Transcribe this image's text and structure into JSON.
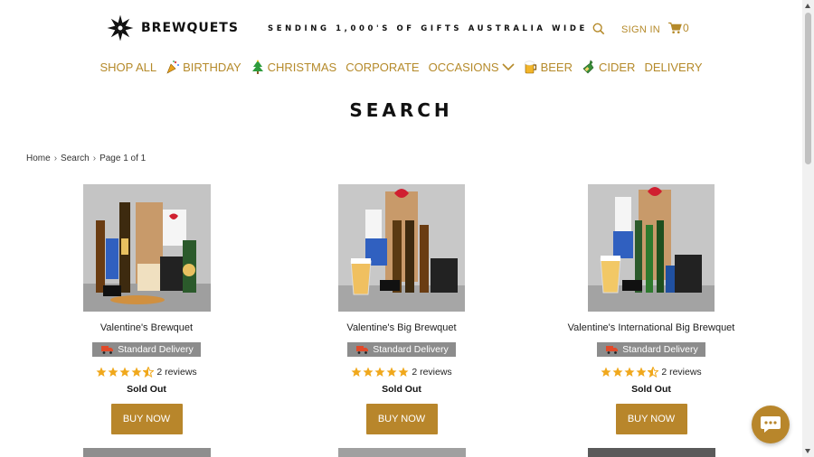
{
  "header": {
    "logo_text": "BREWQUETS",
    "tagline": "SENDING 1,000'S OF GIFTS AUSTRALIA WIDE",
    "signin_label": "SIGN IN",
    "cart_count": "0",
    "accent_color": "#b58a2a"
  },
  "nav": {
    "items": [
      {
        "label": "SHOP ALL",
        "icon": null
      },
      {
        "label": "BIRTHDAY",
        "icon": "party-popper-icon"
      },
      {
        "label": "CHRISTMAS",
        "icon": "christmas-tree-icon"
      },
      {
        "label": "CORPORATE",
        "icon": null
      },
      {
        "label": "OCCASIONS",
        "icon": "chevron-down-icon"
      },
      {
        "label": "BEER",
        "icon": "beer-mug-icon"
      },
      {
        "label": "CIDER",
        "icon": "bottle-icon"
      },
      {
        "label": "DELIVERY",
        "icon": null
      }
    ]
  },
  "page": {
    "title": "SEARCH"
  },
  "breadcrumb": {
    "home": "Home",
    "search": "Search",
    "page": "Page 1 of 1"
  },
  "products": [
    {
      "title": "Valentine's Brewquet",
      "badge": "Standard Delivery",
      "rating": 4.5,
      "reviews": "2 reviews",
      "status": "Sold Out",
      "button": "BUY NOW"
    },
    {
      "title": "Valentine's Big Brewquet",
      "badge": "Standard Delivery",
      "rating": 5,
      "reviews": "2 reviews",
      "status": "Sold Out",
      "button": "BUY NOW"
    },
    {
      "title": "Valentine's International Big Brewquet",
      "badge": "Standard Delivery",
      "rating": 4.5,
      "reviews": "2 reviews",
      "status": "Sold Out",
      "button": "BUY NOW"
    }
  ],
  "colors": {
    "button_bg": "#b8862b",
    "badge_bg": "#8c8c8c",
    "star": "#f0a81c"
  }
}
